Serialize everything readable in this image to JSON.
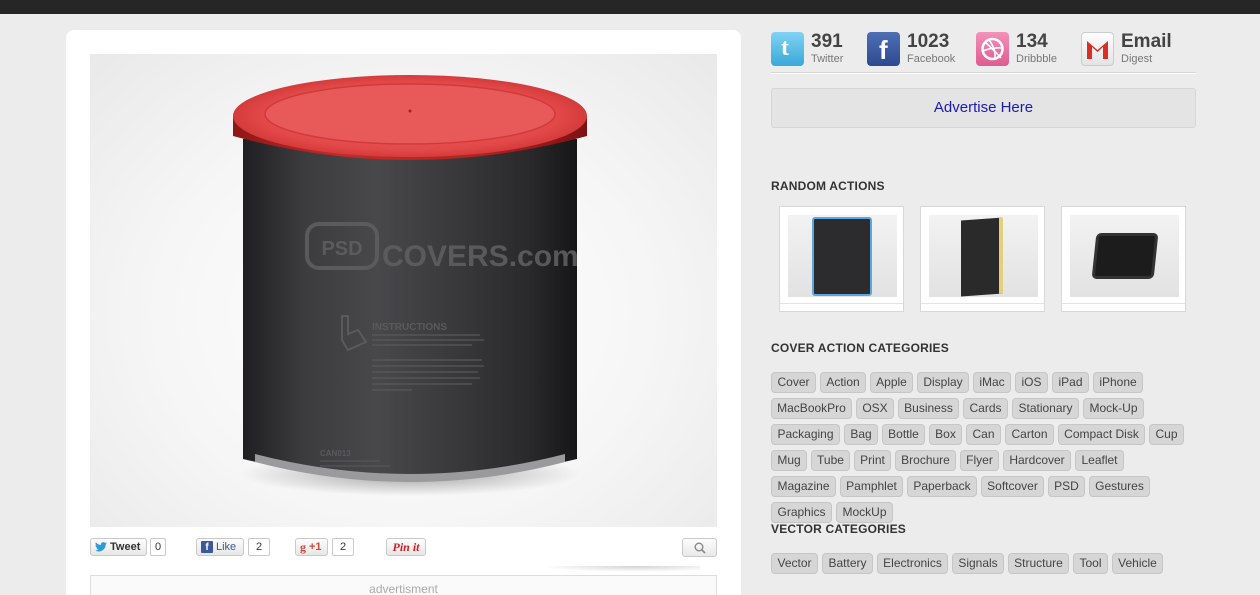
{
  "social": [
    {
      "count": "391",
      "label": "Twitter",
      "icon": "twitter-icon"
    },
    {
      "count": "1023",
      "label": "Facebook",
      "icon": "facebook-icon"
    },
    {
      "count": "134",
      "label": "Dribbble",
      "icon": "dribbble-icon"
    },
    {
      "count": "Email",
      "label": "Digest",
      "icon": "gmail-icon"
    }
  ],
  "advertise_label": "Advertise Here",
  "hero": {
    "brand_text": "COVERS.com",
    "brand_badge": "PSD",
    "instructions_title": "INSTRUCTIONS",
    "product_code": "CAN013"
  },
  "share": {
    "tweet_label": "Tweet",
    "tweet_count": "0",
    "like_label": "Like",
    "like_count": "2",
    "plusone_label": "+1",
    "plusone_count": "2",
    "pinit_label": "Pin it"
  },
  "advert_label": "advertisment",
  "random_actions": {
    "title": "RANDOM ACTIONS",
    "thumbs": [
      "bluray-case-thumb",
      "book-thumb",
      "ipad-thumb"
    ]
  },
  "cover_categories": {
    "title": "COVER ACTION CATEGORIES",
    "tags": [
      "Cover",
      "Action",
      "Apple",
      "Display",
      "iMac",
      "iOS",
      "iPad",
      "iPhone",
      "MacBookPro",
      "OSX",
      "Business",
      "Cards",
      "Stationary",
      "Mock-Up",
      "Packaging",
      "Bag",
      "Bottle",
      "Box",
      "Can",
      "Carton",
      "Compact Disk",
      "Cup",
      "Mug",
      "Tube",
      "Print",
      "Brochure",
      "Flyer",
      "Hardcover",
      "Leaflet",
      "Magazine",
      "Pamphlet",
      "Paperback",
      "Softcover",
      "PSD",
      "Gestures",
      "Graphics",
      "MockUp"
    ]
  },
  "vector_categories": {
    "title": "VECTOR CATEGORIES",
    "tags": [
      "Vector",
      "Battery",
      "Electronics",
      "Signals",
      "Structure",
      "Tool",
      "Vehicle"
    ]
  },
  "colors": {
    "can_body": "#3a3a3c",
    "can_lid": "#c42a2a",
    "link_blue": "#1a1ab8",
    "tag_bg": "#d6d6d6"
  }
}
